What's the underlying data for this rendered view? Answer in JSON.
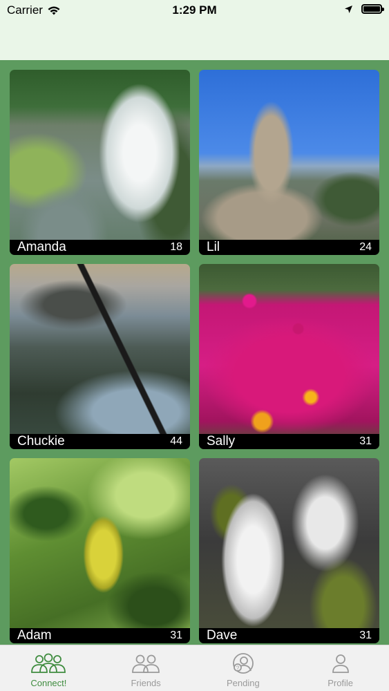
{
  "status": {
    "carrier": "Carrier",
    "time": "1:29 PM"
  },
  "cards": [
    {
      "name": "Amanda",
      "count": "18"
    },
    {
      "name": "Lil",
      "count": "24"
    },
    {
      "name": "Chuckie",
      "count": "44"
    },
    {
      "name": "Sally",
      "count": "31"
    },
    {
      "name": "Adam",
      "count": "31"
    },
    {
      "name": "Dave",
      "count": "31"
    }
  ],
  "tabs": [
    {
      "label": "Connect!",
      "icon": "group-icon",
      "active": true
    },
    {
      "label": "Friends",
      "icon": "friends-icon"
    },
    {
      "label": "Pending",
      "icon": "pending-icon"
    },
    {
      "label": "Profile",
      "icon": "profile-icon"
    }
  ],
  "colors": {
    "accent": "#3f8c3f",
    "grid_background": "#5d9b5f",
    "header_background": "#eaf6e8",
    "tab_inactive": "#9a9a9a"
  }
}
